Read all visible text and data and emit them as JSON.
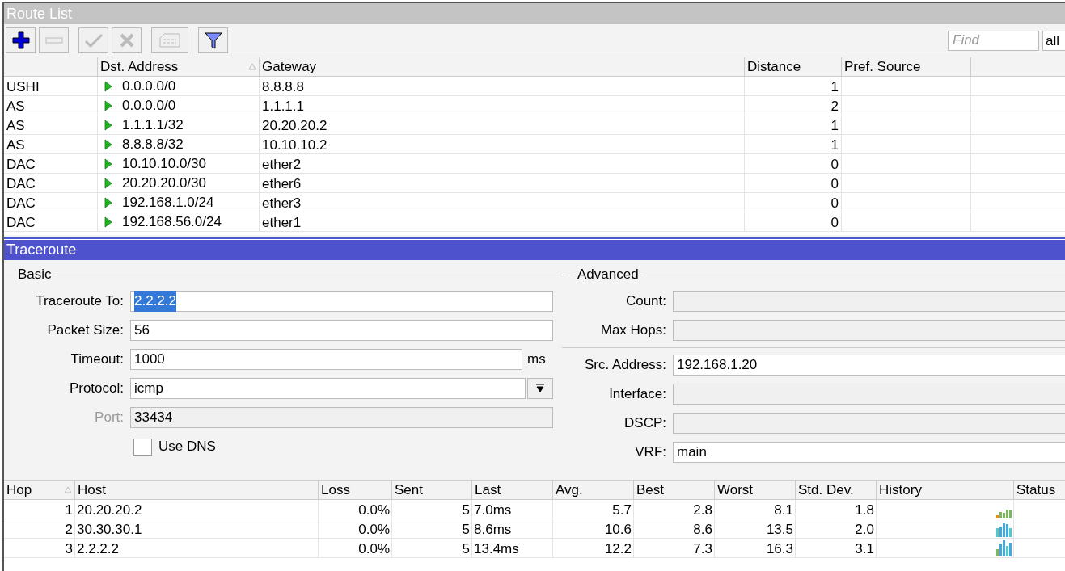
{
  "route_list": {
    "title": "Route List",
    "toolbar": [
      {
        "kind": "add",
        "disabled": false
      },
      {
        "kind": "remove",
        "disabled": true
      },
      {
        "kind": "enable",
        "disabled": true
      },
      {
        "kind": "disable",
        "disabled": true
      },
      {
        "kind": "comment",
        "disabled": true
      },
      {
        "kind": "filter",
        "disabled": false
      }
    ],
    "search": {
      "placeholder": "Find"
    },
    "scope": "all",
    "columns": [
      "",
      "Dst. Address",
      "Gateway",
      "Distance",
      "Pref. Source"
    ],
    "rows": [
      {
        "flags": "USHI",
        "active": true,
        "dst": "0.0.0.0/0",
        "gateway": "8.8.8.8",
        "distance": "1"
      },
      {
        "flags": "AS",
        "active": true,
        "dst": "0.0.0.0/0",
        "gateway": "1.1.1.1",
        "distance": "2"
      },
      {
        "flags": "AS",
        "active": true,
        "dst": "1.1.1.1/32",
        "gateway": "20.20.20.2",
        "distance": "1"
      },
      {
        "flags": "AS",
        "active": true,
        "dst": "8.8.8.8/32",
        "gateway": "10.10.10.2",
        "distance": "1"
      },
      {
        "flags": "DAC",
        "active": true,
        "dst": "10.10.10.0/30",
        "gateway": "ether2",
        "distance": "0"
      },
      {
        "flags": "DAC",
        "active": true,
        "dst": "20.20.20.0/30",
        "gateway": "ether6",
        "distance": "0"
      },
      {
        "flags": "DAC",
        "active": true,
        "dst": "192.168.1.0/24",
        "gateway": "ether3",
        "distance": "0"
      },
      {
        "flags": "DAC",
        "active": true,
        "dst": "192.168.56.0/24",
        "gateway": "ether1",
        "distance": "0"
      }
    ]
  },
  "traceroute": {
    "title": "Traceroute",
    "basic": {
      "title": "Basic",
      "fields": [
        {
          "kind": "text",
          "label": "Traceroute To:",
          "value": "2.2.2.2",
          "highlighted": true,
          "disabled": false
        },
        {
          "kind": "text",
          "label": "Packet Size:",
          "value": "56",
          "highlighted": false,
          "disabled": false
        },
        {
          "kind": "unit",
          "label": "Timeout:",
          "value": "1000",
          "unit": "ms",
          "highlighted": false,
          "disabled": false
        },
        {
          "kind": "select",
          "label": "Protocol:",
          "value": "icmp",
          "highlighted": false,
          "disabled": false
        },
        {
          "kind": "text",
          "label": "Port:",
          "value": "33434",
          "highlighted": false,
          "disabled": true
        },
        {
          "kind": "checkbox",
          "label": "Use DNS",
          "checked": false
        }
      ]
    },
    "advanced": {
      "title": "Advanced",
      "fields": [
        {
          "kind": "text",
          "label": "Count:"
        },
        {
          "kind": "text",
          "label": "Max Hops:"
        },
        {
          "kind": "separator"
        },
        {
          "kind": "text",
          "label": "Src. Address:",
          "value": "192.168.1.20"
        },
        {
          "kind": "text",
          "label": "Interface:"
        },
        {
          "kind": "text",
          "label": "DSCP:"
        },
        {
          "kind": "text",
          "label": "VRF:",
          "value": "main"
        }
      ]
    },
    "results": {
      "columns": [
        "Hop",
        "Host",
        "Loss",
        "Sent",
        "Last",
        "Avg.",
        "Best",
        "Worst",
        "Std. Dev.",
        "History",
        "Status"
      ],
      "rows": [
        {
          "hop": "1",
          "host": "20.20.20.2",
          "loss": "0.0%",
          "sent": "5",
          "last": "7.0ms",
          "avg": "5.7",
          "best": "2.8",
          "worst": "8.1",
          "std_dev": "1.8"
        },
        {
          "hop": "2",
          "host": "30.30.30.1",
          "loss": "0.0%",
          "sent": "5",
          "last": "8.6ms",
          "avg": "10.6",
          "best": "8.6",
          "worst": "13.5",
          "std_dev": "2.0"
        },
        {
          "hop": "3",
          "host": "2.2.2.2",
          "loss": "0.0%",
          "sent": "5",
          "last": "13.4ms",
          "avg": "12.2",
          "best": "7.3",
          "worst": "16.3",
          "std_dev": "3.1"
        }
      ]
    }
  }
}
